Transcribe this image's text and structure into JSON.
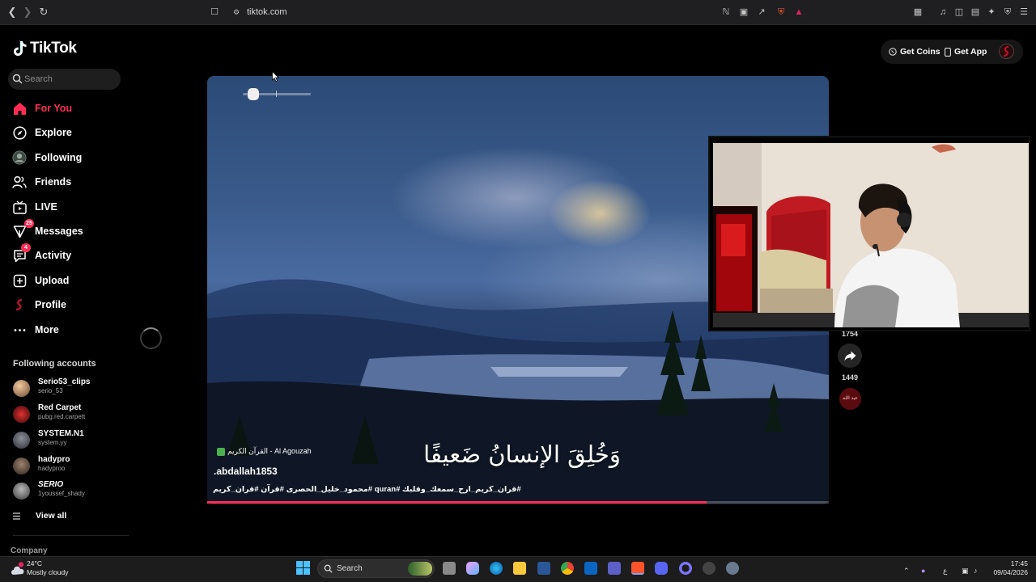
{
  "browser": {
    "url": "tiktok.com"
  },
  "brand": {
    "name": "TikTok",
    "accent": "#fe2c55"
  },
  "search": {
    "placeholder": "Search"
  },
  "nav": [
    {
      "id": "for-you",
      "label": "For You",
      "icon": "home-icon",
      "active": true
    },
    {
      "id": "explore",
      "label": "Explore",
      "icon": "compass-icon"
    },
    {
      "id": "following",
      "label": "Following",
      "icon": "following-avatar-icon"
    },
    {
      "id": "friends",
      "label": "Friends",
      "icon": "friends-icon"
    },
    {
      "id": "live",
      "label": "LIVE",
      "icon": "live-tv-icon"
    },
    {
      "id": "messages",
      "label": "Messages",
      "icon": "message-icon",
      "badge": "25"
    },
    {
      "id": "activity",
      "label": "Activity",
      "icon": "activity-icon",
      "badge": "4"
    },
    {
      "id": "upload",
      "label": "Upload",
      "icon": "upload-icon"
    },
    {
      "id": "profile",
      "label": "Profile",
      "icon": "profile-icon"
    },
    {
      "id": "more",
      "label": "More",
      "icon": "more-dots-icon"
    }
  ],
  "following_accounts": {
    "title": "Following accounts",
    "items": [
      {
        "name": "Serio53_clips",
        "handle": "serio_53"
      },
      {
        "name": "Red Carpet",
        "handle": "pubg.red.carpett"
      },
      {
        "name": "SYSTEM.N1",
        "handle": "system.yy"
      },
      {
        "name": "hadypro",
        "handle": "hadyproo"
      },
      {
        "name": "SERIO",
        "handle": "1youssef_shady"
      }
    ],
    "view_all": "View all"
  },
  "footer": {
    "company": "Company"
  },
  "topbar": {
    "get_coins": "Get Coins",
    "get_app": "Get App"
  },
  "video": {
    "caption": "وَخُلِقَ الإنسانُ ضَعيفًا",
    "music": "القرآن الكريم - Al Agouzah",
    "author": ".abdallah1853",
    "tags": "#قران_كريم_ارح_سمعك_وقلبك #quran #محمود_خليل_الحصرى #قرآن #قران_كريم",
    "progress": 0.803,
    "volume": 0.15
  },
  "actions": {
    "favorites_count": "1754",
    "share_count": "1449",
    "sound_label": "عبد الله"
  },
  "taskbar": {
    "weather_temp": "24°C",
    "weather_desc": "Mostly cloudy",
    "weather_alert": "1",
    "search_label": "Search",
    "lang": "ع",
    "time": "17:45",
    "date": "09/04/2026"
  }
}
